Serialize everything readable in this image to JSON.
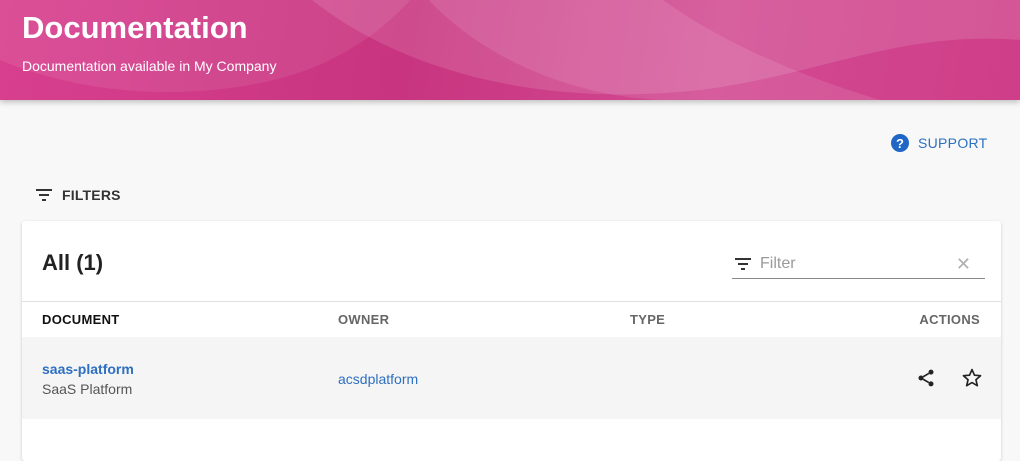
{
  "header": {
    "title": "Documentation",
    "subtitle": "Documentation available in My Company",
    "accent_color": "#cc3a85"
  },
  "support": {
    "label": "SUPPORT",
    "icon": "help-icon",
    "color": "#2d6fc1"
  },
  "filters": {
    "label": "FILTERS",
    "icon": "filter-icon"
  },
  "card": {
    "title": "All (1)",
    "filter_input": {
      "placeholder": "Filter",
      "value": ""
    },
    "columns": [
      "DOCUMENT",
      "OWNER",
      "TYPE",
      "ACTIONS"
    ],
    "rows": [
      {
        "document_name": "saas-platform",
        "document_title": "SaaS Platform",
        "owner": "acsdplatform",
        "type": "",
        "actions": [
          "share-icon",
          "star-icon"
        ]
      }
    ]
  }
}
